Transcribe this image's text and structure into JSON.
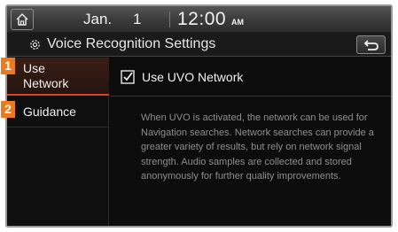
{
  "statusbar": {
    "date": "Jan.",
    "day": "1",
    "time": "12:00",
    "ampm": "AM"
  },
  "titlebar": {
    "title": "Voice Recognition Settings"
  },
  "menu": {
    "items": [
      {
        "label": "Use\nNetwork",
        "badge": "1"
      },
      {
        "label": "Guidance",
        "badge": "2"
      }
    ]
  },
  "content": {
    "option_label": "Use UVO Network",
    "checked": true,
    "description": "When UVO is activated, the network can be used for Navigation searches. Network searches can provide a greater variety of results, but rely on network signal strength. Audio samples are collected and stored anonymously for further quality improvements."
  },
  "colors": {
    "accent": "#d8451b",
    "badge": "#ec7a1d"
  }
}
